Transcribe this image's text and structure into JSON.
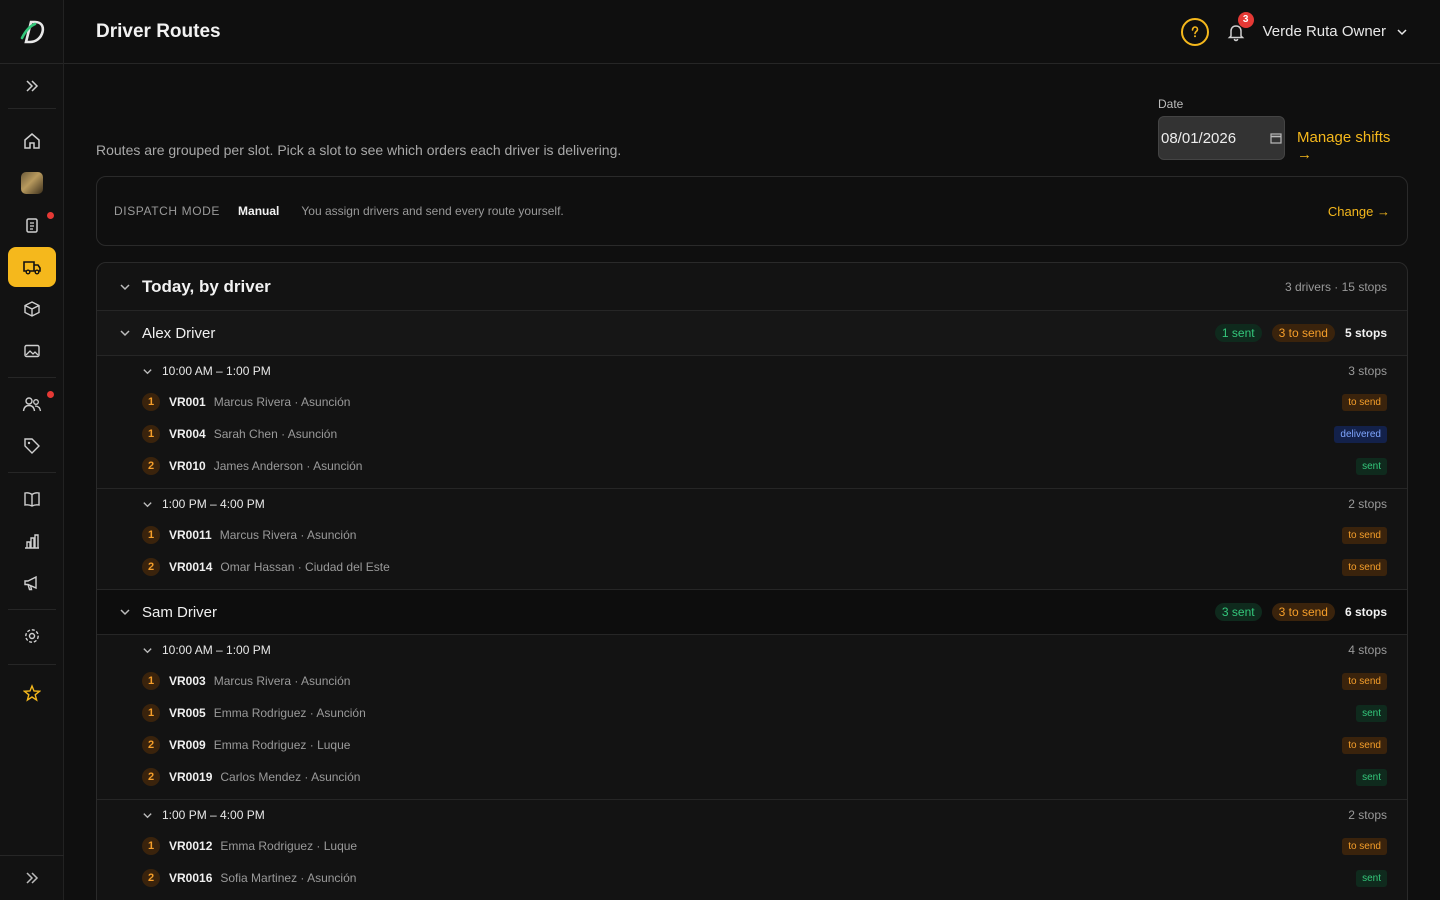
{
  "header": {
    "title": "Driver Routes",
    "notifications": "3",
    "user": "Verde Ruta Owner"
  },
  "intro": "Routes are grouped per slot. Pick a slot to see which orders each driver is delivering.",
  "date": {
    "label": "Date",
    "value": "08/01/2026"
  },
  "manage_shifts": "Manage shifts →",
  "dispatch": {
    "label": "DISPATCH MODE",
    "mode": "Manual",
    "description": "You assign drivers and send every route yourself.",
    "change": "Change →"
  },
  "panel": {
    "title": "Today, by driver",
    "summary": "3 drivers · 15 stops"
  },
  "drivers": [
    {
      "name": "Alex Driver",
      "sent": "1 sent",
      "to_send": "3 to send",
      "stops": "5 stops",
      "slots": [
        {
          "label": "10:00 AM – 1:00 PM",
          "stops": "3 stops",
          "orders": [
            {
              "seq": "1",
              "id": "VR001",
              "sub": "Marcus Rivera · Asunción",
              "status": "to send"
            },
            {
              "seq": "1",
              "id": "VR004",
              "sub": "Sarah Chen · Asunción",
              "status": "delivered"
            },
            {
              "seq": "2",
              "id": "VR010",
              "sub": "James Anderson · Asunción",
              "status": "sent"
            }
          ]
        },
        {
          "label": "1:00 PM – 4:00 PM",
          "stops": "2 stops",
          "orders": [
            {
              "seq": "1",
              "id": "VR0011",
              "sub": "Marcus Rivera · Asunción",
              "status": "to send"
            },
            {
              "seq": "2",
              "id": "VR0014",
              "sub": "Omar Hassan · Ciudad del Este",
              "status": "to send"
            }
          ]
        }
      ]
    },
    {
      "name": "Sam Driver",
      "sent": "3 sent",
      "to_send": "3 to send",
      "stops": "6 stops",
      "slots": [
        {
          "label": "10:00 AM – 1:00 PM",
          "stops": "4 stops",
          "orders": [
            {
              "seq": "1",
              "id": "VR003",
              "sub": "Marcus Rivera · Asunción",
              "status": "to send"
            },
            {
              "seq": "1",
              "id": "VR005",
              "sub": "Emma Rodriguez · Asunción",
              "status": "sent"
            },
            {
              "seq": "2",
              "id": "VR009",
              "sub": "Emma Rodriguez · Luque",
              "status": "to send"
            },
            {
              "seq": "2",
              "id": "VR0019",
              "sub": "Carlos Mendez · Asunción",
              "status": "sent"
            }
          ]
        },
        {
          "label": "1:00 PM – 4:00 PM",
          "stops": "2 stops",
          "orders": [
            {
              "seq": "1",
              "id": "VR0012",
              "sub": "Emma Rodriguez · Luque",
              "status": "to send"
            },
            {
              "seq": "2",
              "id": "VR0016",
              "sub": "Sofia Martinez · Asunción",
              "status": "sent"
            }
          ]
        }
      ]
    }
  ],
  "colors": {
    "accent": "#f5b81c",
    "sent": "#34c77b",
    "to_send": "#f59e2a",
    "delivered": "#7fa6ff",
    "alert": "#e53935"
  },
  "icons": [
    "logo-icon",
    "expand-icon",
    "home-icon",
    "orders-icon",
    "truck-icon",
    "box-icon",
    "image-icon",
    "users-icon",
    "tag-icon",
    "book-icon",
    "chart-icon",
    "megaphone-icon",
    "settings-icon",
    "star-icon",
    "help-icon",
    "bell-icon",
    "chevron-down-icon",
    "calendar-icon"
  ]
}
